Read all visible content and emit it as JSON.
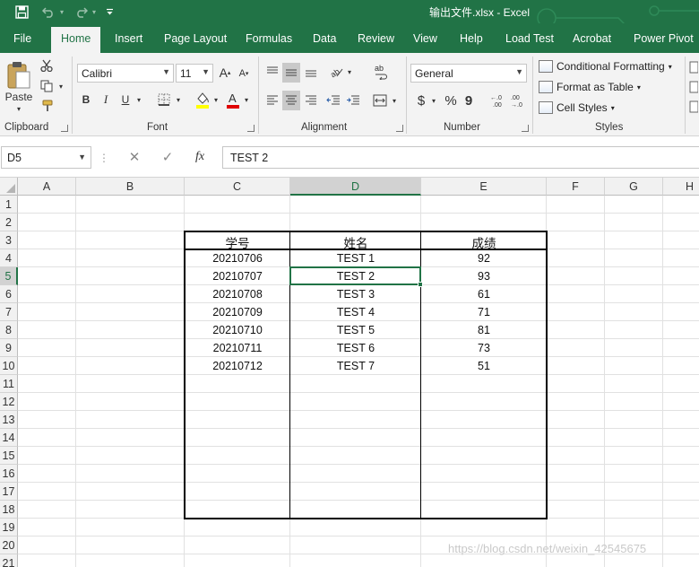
{
  "titlebar": {
    "title": "输出文件.xlsx  -  Excel",
    "icons": [
      "save-icon",
      "undo-icon",
      "redo-icon",
      "customize-qat-icon"
    ]
  },
  "tabs": [
    "File",
    "Home",
    "Insert",
    "Page Layout",
    "Formulas",
    "Data",
    "Review",
    "View",
    "Help",
    "Load Test",
    "Acrobat",
    "Power Pivot"
  ],
  "active_tab": "Home",
  "ribbon": {
    "clipboard": {
      "label": "Clipboard",
      "paste_label": "Paste"
    },
    "font": {
      "label": "Font",
      "font_name": "Calibri",
      "font_size": "11",
      "bold": "B",
      "italic": "I",
      "underline": "U"
    },
    "alignment": {
      "label": "Alignment"
    },
    "number": {
      "label": "Number",
      "format": "General",
      "currency": "$",
      "percent": "%",
      "comma": "9"
    },
    "styles": {
      "label": "Styles",
      "conditional_formatting": "Conditional Formatting",
      "format_as_table": "Format as Table",
      "cell_styles": "Cell Styles"
    }
  },
  "formula_bar": {
    "name_box": "D5",
    "cancel": "✕",
    "enter": "✓",
    "fx": "fx",
    "value": "TEST 2"
  },
  "columns": [
    "A",
    "B",
    "C",
    "D",
    "E",
    "F",
    "G",
    "H"
  ],
  "rows": [
    "1",
    "2",
    "3",
    "4",
    "5",
    "6",
    "7",
    "8",
    "9",
    "10",
    "11",
    "12",
    "13",
    "14",
    "15",
    "16",
    "17",
    "18",
    "19",
    "20",
    "21"
  ],
  "selected_cell": {
    "column": "D",
    "row": "5"
  },
  "table": {
    "headers": [
      "学号",
      "姓名",
      "成绩"
    ],
    "rows": [
      [
        "20210706",
        "TEST 1",
        "92"
      ],
      [
        "20210707",
        "TEST 2",
        "93"
      ],
      [
        "20210708",
        "TEST 3",
        "61"
      ],
      [
        "20210709",
        "TEST 4",
        "71"
      ],
      [
        "20210710",
        "TEST 5",
        "81"
      ],
      [
        "20210711",
        "TEST 6",
        "73"
      ],
      [
        "20210712",
        "TEST 7",
        "51"
      ]
    ]
  },
  "watermark": "https://blog.csdn.net/weixin_42545675",
  "colors": {
    "accent": "#217346",
    "header_bg": "#f1f1f1",
    "selected_header_bg": "#d2d2d2"
  }
}
